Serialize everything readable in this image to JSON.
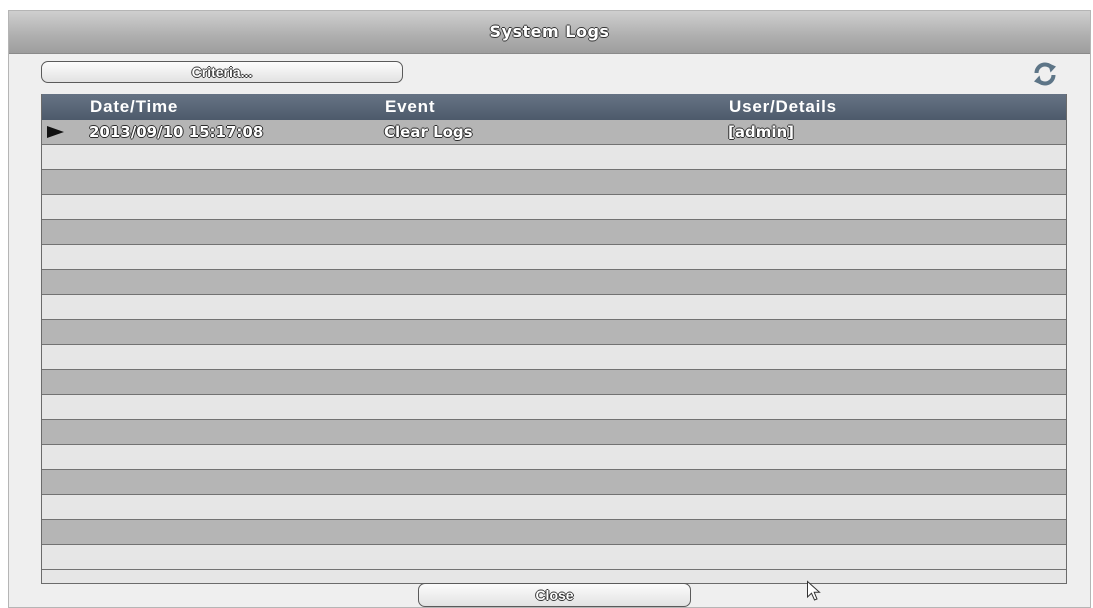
{
  "window": {
    "title": "System Logs"
  },
  "toolbar": {
    "criteria_label": "Criteria...",
    "refresh_icon": "refresh-icon"
  },
  "table": {
    "columns": [
      "Date/Time",
      "Event",
      "User/Details"
    ],
    "rows": [
      {
        "selected": true,
        "date_time": "2013/09/10 15:17:08",
        "event": "Clear Logs",
        "user_details": "[admin]"
      }
    ],
    "empty_row_count": 17
  },
  "footer": {
    "close_label": "Close"
  },
  "colors": {
    "header_bg": "#56636f",
    "row_dark": "#b5b5b5",
    "row_light": "#e6e6e6",
    "refresh_icon": "#5d7587"
  }
}
